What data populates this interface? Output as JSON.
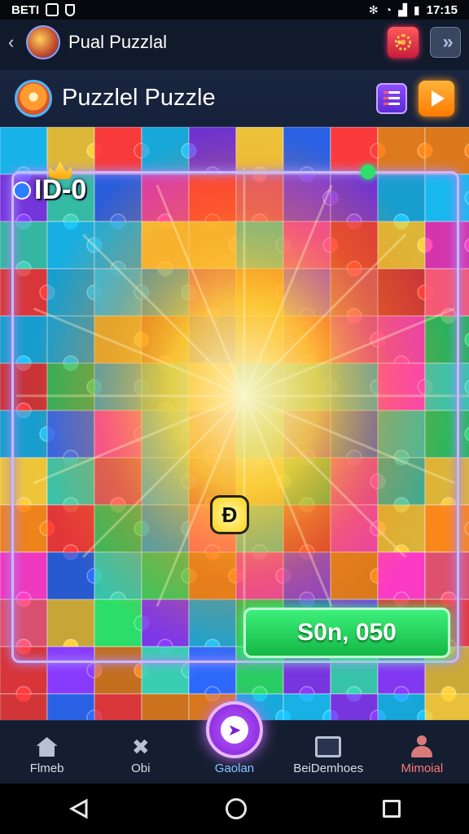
{
  "status_bar": {
    "left_text": "BETI",
    "time": "17:15",
    "signal_icon": "signal-icon",
    "wifi_icon": "wifi-icon",
    "battery_icon": "battery-icon"
  },
  "app_bar": {
    "title": "Pual Puzzlal"
  },
  "puzzle_header": {
    "title": "Puzzlel Puzzle"
  },
  "board": {
    "id_label": "ID-0",
    "center_token": "Ɖ",
    "score_button": "S0n, 050",
    "accent_colors": [
      "#ff3b3b",
      "#ff8a1a",
      "#ffd23a",
      "#2de06a",
      "#18c6ff",
      "#2d6bff",
      "#8a3bff",
      "#ff3bc8",
      "#ff5a7a",
      "#3bd6b8"
    ]
  },
  "bottom_nav": {
    "items": [
      {
        "label": "Flmeb",
        "icon": "home-icon"
      },
      {
        "label": "Obi",
        "icon": "tools-icon"
      },
      {
        "label": "Gaolan",
        "icon": "play-compass-icon"
      },
      {
        "label": "BeiDemhoes",
        "icon": "tray-icon"
      },
      {
        "label": "Mimoial",
        "icon": "profile-icon"
      }
    ]
  }
}
